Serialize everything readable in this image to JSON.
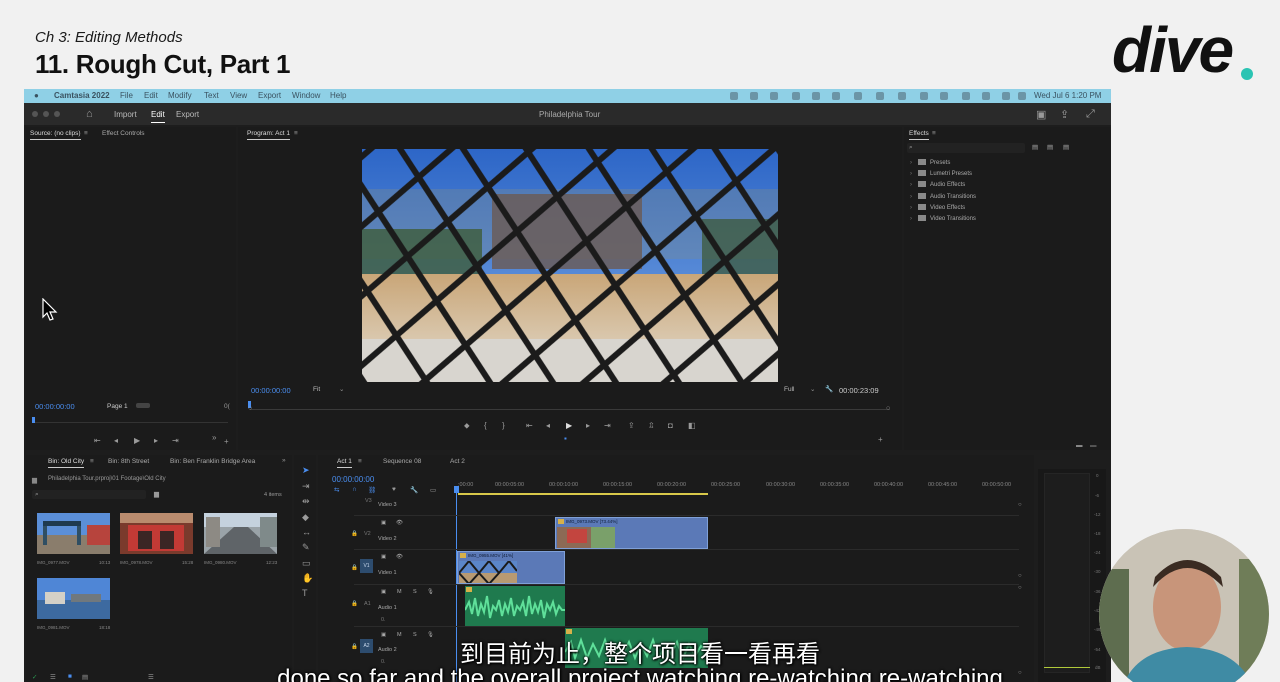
{
  "course": {
    "chapter": "Ch 3: Editing Methods",
    "title": "11. Rough Cut, Part 1",
    "brand": "dive",
    "brand_accent": "#2ac4b3"
  },
  "menubar": {
    "app_name": "Camtasia 2022",
    "menus": [
      "File",
      "Edit",
      "Modify",
      "Text",
      "View",
      "Export",
      "Window",
      "Help"
    ],
    "clock": "Wed Jul 6  1:20 PM"
  },
  "app_header": {
    "workspaces": [
      "Import",
      "Edit",
      "Export"
    ],
    "active_workspace": "Edit",
    "project_title": "Philadelphia Tour"
  },
  "source_monitor": {
    "tab_source": "Source: (no clips)",
    "tab_effect_controls": "Effect Controls",
    "timecode": "00:00:00:00",
    "page": "Page 1",
    "right_tc": "0("
  },
  "program_monitor": {
    "tab": "Program: Act 1",
    "timecode": "00:00:00:00",
    "fit": "Fit",
    "quality": "Full",
    "duration": "00:00:23:09"
  },
  "effects": {
    "tab": "Effects",
    "items": [
      "Presets",
      "Lumetri Presets",
      "Audio Effects",
      "Audio Transitions",
      "Video Effects",
      "Video Transitions"
    ]
  },
  "project_bins": {
    "tabs": [
      "Bin: Old City",
      "Bin: 8th Street",
      "Bin: Ben Franklin Bridge Area"
    ],
    "path": "Philadelphia Tour.prproj\\01 Footage\\Old City",
    "count": "4 items",
    "clips": [
      {
        "name": "IMG_0977.MOV",
        "dur": "10:13"
      },
      {
        "name": "IMG_0978.MOV",
        "dur": "15:28"
      },
      {
        "name": "IMG_0980.MOV",
        "dur": "12:23"
      },
      {
        "name": "IMG_0981.MOV",
        "dur": "18:18"
      }
    ]
  },
  "timeline": {
    "tabs": [
      "Act 1",
      "Sequence 08",
      "Act 2"
    ],
    "timecode": "00:00:00:00",
    "ruler": [
      ":00:00",
      "00:00:05:00",
      "00:00:10:00",
      "00:00:15:00",
      "00:00:20:00",
      "00:00:25:00",
      "00:00:30:00",
      "00:00:35:00",
      "00:00:40:00",
      "00:00:45:00",
      "00:00:50:00"
    ],
    "tracks": {
      "v3": "Video 3",
      "v2": "Video 2",
      "v1": "Video 1",
      "a1": "Audio 1",
      "a2": "Audio 2"
    },
    "track_ids": [
      "V3",
      "V2",
      "V1",
      "A1",
      "A2"
    ],
    "clips": {
      "v2": "IMG_0973.MOV [73.44%]",
      "v1": "IMG_0955.MOV [41%]"
    },
    "meter_labels": [
      "0",
      "-6",
      "-12",
      "-18",
      "-24",
      "-30",
      "-36",
      "-42",
      "-48",
      "-54",
      "dB"
    ]
  },
  "subtitles": {
    "cn": "到目前为止，整个项目看一看再看",
    "en": "done so far and the overall project watching re-watching re-watching"
  }
}
